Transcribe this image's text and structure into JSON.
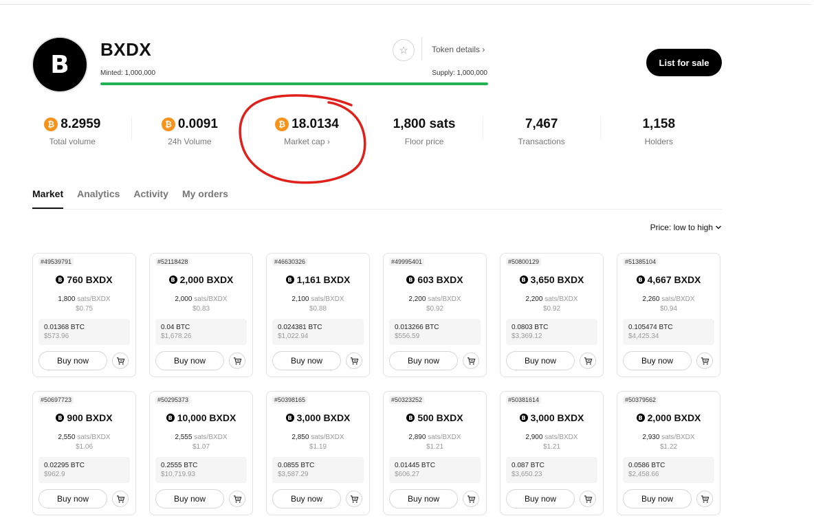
{
  "token": {
    "logo_letter": "B",
    "name": "BXDX",
    "details_link": "Token details ›",
    "minted": "Minted: 1,000,000",
    "supply": "Supply: 1,000,000",
    "minted_fraction": 1.0,
    "list_button": "List for sale"
  },
  "colors": {
    "accent_green": "#22b256",
    "btc_orange": "#f7931a",
    "annotation_red": "#e0211b"
  },
  "stats": [
    {
      "value": "8.2959",
      "label": "Total volume",
      "btc": true
    },
    {
      "value": "0.0091",
      "label": "24h Volume",
      "btc": true
    },
    {
      "value": "18.0134",
      "label": "Market cap ›",
      "btc": true
    },
    {
      "value": "1,800 sats",
      "label": "Floor price",
      "btc": false
    },
    {
      "value": "7,467",
      "label": "Transactions",
      "btc": false
    },
    {
      "value": "1,158",
      "label": "Holders",
      "btc": false
    }
  ],
  "tabs": [
    "Market",
    "Analytics",
    "Activity",
    "My orders"
  ],
  "sort_label": "Price: low to high",
  "buy_label": "Buy now",
  "listings": [
    {
      "id": "#49539791",
      "amount": "760 BXDX",
      "sats": "1,800",
      "unit_usd": "$0.75",
      "total_btc": "0.01368 BTC",
      "total_usd": "$573.96"
    },
    {
      "id": "#52118428",
      "amount": "2,000 BXDX",
      "sats": "2,000",
      "unit_usd": "$0.83",
      "total_btc": "0.04 BTC",
      "total_usd": "$1,678.26"
    },
    {
      "id": "#46630326",
      "amount": "1,161 BXDX",
      "sats": "2,100",
      "unit_usd": "$0.88",
      "total_btc": "0.024381 BTC",
      "total_usd": "$1,022.94"
    },
    {
      "id": "#49995401",
      "amount": "603 BXDX",
      "sats": "2,200",
      "unit_usd": "$0.92",
      "total_btc": "0.013266 BTC",
      "total_usd": "$556.59"
    },
    {
      "id": "#50800129",
      "amount": "3,650 BXDX",
      "sats": "2,200",
      "unit_usd": "$0.92",
      "total_btc": "0.0803 BTC",
      "total_usd": "$3,369.12"
    },
    {
      "id": "#51385104",
      "amount": "4,667 BXDX",
      "sats": "2,260",
      "unit_usd": "$0.94",
      "total_btc": "0.105474 BTC",
      "total_usd": "$4,425.34"
    },
    {
      "id": "#50697723",
      "amount": "900 BXDX",
      "sats": "2,550",
      "unit_usd": "$1.06",
      "total_btc": "0.02295 BTC",
      "total_usd": "$962.9"
    },
    {
      "id": "#50295373",
      "amount": "10,000 BXDX",
      "sats": "2,555",
      "unit_usd": "$1.07",
      "total_btc": "0.2555 BTC",
      "total_usd": "$10,719.93"
    },
    {
      "id": "#50398165",
      "amount": "3,000 BXDX",
      "sats": "2,850",
      "unit_usd": "$1.19",
      "total_btc": "0.0855 BTC",
      "total_usd": "$3,587.29"
    },
    {
      "id": "#50323252",
      "amount": "500 BXDX",
      "sats": "2,890",
      "unit_usd": "$1.21",
      "total_btc": "0.01445 BTC",
      "total_usd": "$606.27"
    },
    {
      "id": "#50381614",
      "amount": "3,000 BXDX",
      "sats": "2,900",
      "unit_usd": "$1.21",
      "total_btc": "0.087 BTC",
      "total_usd": "$3,650.23"
    },
    {
      "id": "#50379562",
      "amount": "2,000 BXDX",
      "sats": "2,930",
      "unit_usd": "$1.22",
      "total_btc": "0.0586 BTC",
      "total_usd": "$2,458.66"
    }
  ],
  "unit_label": "sats/BXDX"
}
